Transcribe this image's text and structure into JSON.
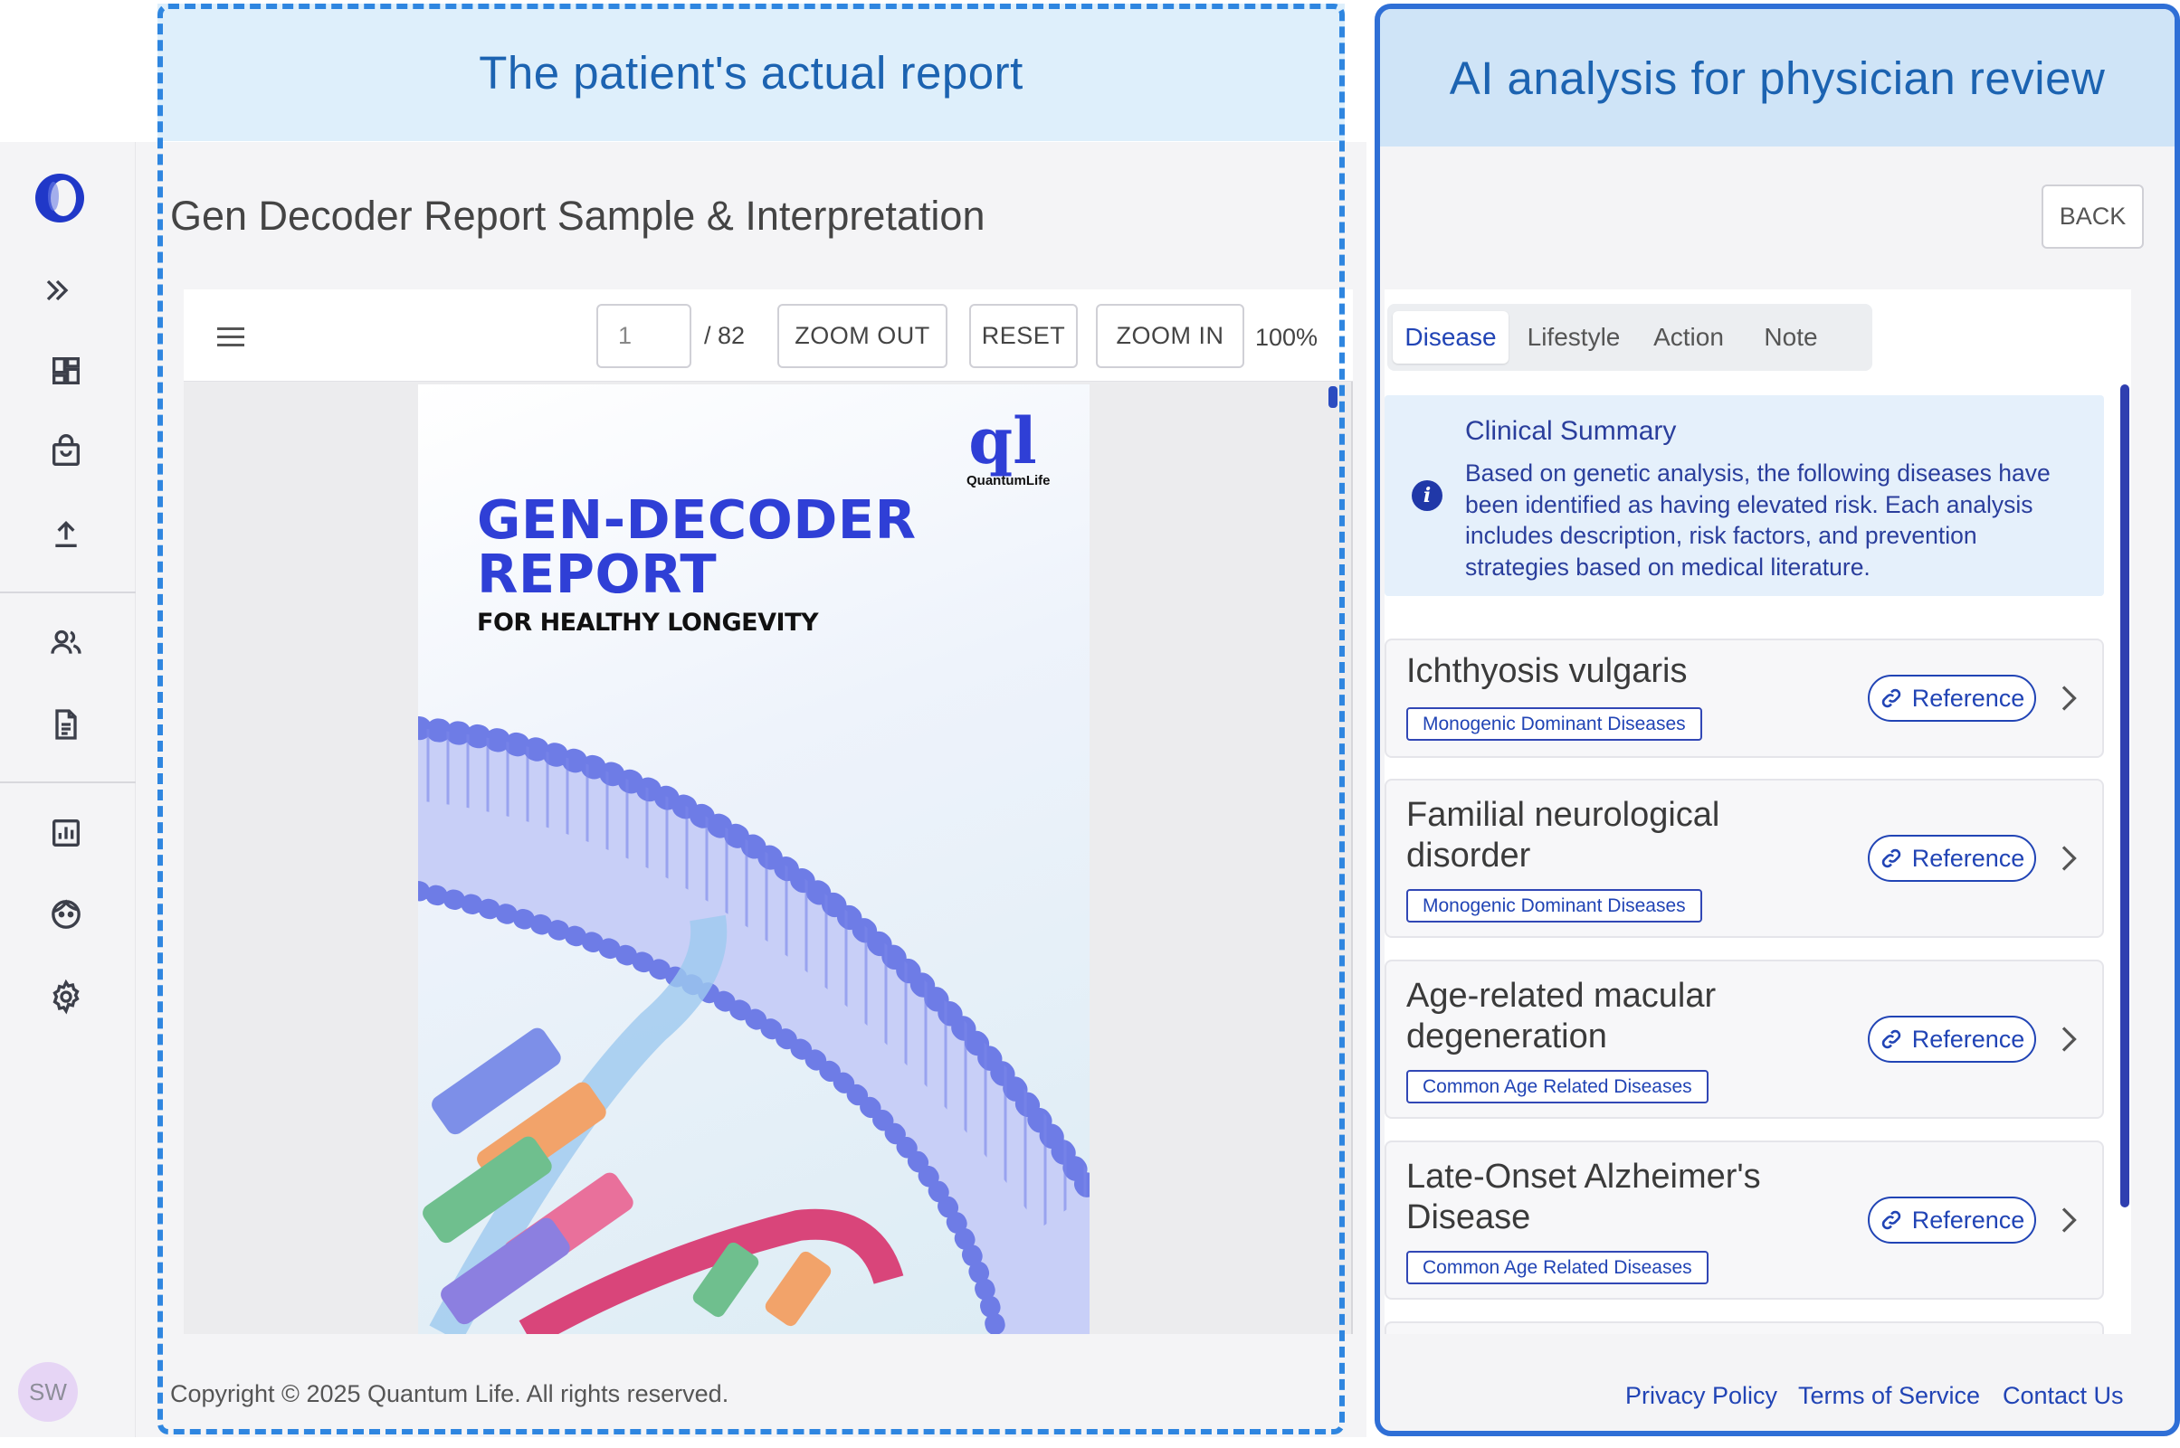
{
  "left_panel": {
    "caption": "The patient's actual report"
  },
  "right_panel": {
    "caption": "AI analysis for physician review"
  },
  "sidebar": {
    "icons": [
      "expand-icon",
      "dashboard-icon",
      "shopping-bag-icon",
      "upload-icon",
      "users-icon",
      "report-icon",
      "chart-icon",
      "face-icon",
      "settings-icon"
    ],
    "avatar_initials": "SW"
  },
  "page": {
    "title": "Gen Decoder Report Sample & Interpretation"
  },
  "viewer": {
    "page_number": "1",
    "page_total": "/ 82",
    "zoom_out": "ZOOM OUT",
    "reset": "RESET",
    "zoom_in": "ZOOM IN",
    "zoom_level": "100%"
  },
  "cover": {
    "title_line1": "GEN-DECODER",
    "title_line2": "REPORT",
    "subtitle": "FOR HEALTHY LONGEVITY",
    "brand_mark": "ql",
    "brand_name": "QuantumLife"
  },
  "footer": {
    "copyright": "Copyright © 2025 Quantum Life. All rights reserved.",
    "privacy": "Privacy Policy",
    "terms": "Terms of Service",
    "contact": "Contact Us"
  },
  "analysis": {
    "back": "BACK",
    "tabs": [
      "Disease",
      "Lifestyle",
      "Action",
      "Note"
    ],
    "active_tab": "Disease",
    "summary_title": "Clinical Summary",
    "summary_text": "Based on genetic analysis, the following diseases have been identified as having elevated risk. Each analysis includes description, risk factors, and prevention strategies based on medical literature.",
    "reference_label": "Reference",
    "diseases": [
      {
        "name": "Ichthyosis vulgaris",
        "tag": "Monogenic Dominant Diseases"
      },
      {
        "name": "Familial neurological disorder",
        "tag": "Monogenic Dominant Diseases"
      },
      {
        "name": "Age-related macular degeneration",
        "tag": "Common Age Related Diseases"
      },
      {
        "name": "Late-Onset Alzheimer's Disease",
        "tag": "Common Age Related Diseases"
      }
    ]
  },
  "colors": {
    "accent": "#2144b5",
    "banner_left": "#deeffb",
    "banner_right": "#cfe4f7",
    "dashed_border": "#2f86e0",
    "panel_border": "#2f6fd6"
  }
}
